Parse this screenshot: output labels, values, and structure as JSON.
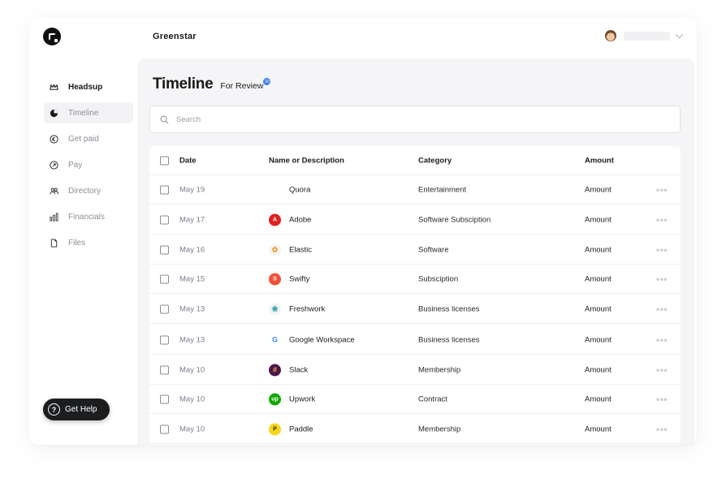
{
  "app": {
    "name": "Greenstar"
  },
  "nav": {
    "items": [
      {
        "label": "Headsup",
        "icon": "crown-icon"
      },
      {
        "label": "Timeline",
        "icon": "pie-chart-icon"
      },
      {
        "label": "Get paid",
        "icon": "euro-circle-icon"
      },
      {
        "label": "Pay",
        "icon": "send-circle-icon"
      },
      {
        "label": "Directory",
        "icon": "users-icon"
      },
      {
        "label": "Financials",
        "icon": "bar-chart-icon"
      },
      {
        "label": "Files",
        "icon": "file-icon"
      }
    ],
    "active": "Timeline"
  },
  "help": {
    "label": "Get Help",
    "icon_glyph": "?"
  },
  "page": {
    "title": "Timeline",
    "subtitle": "For Review",
    "badge": "20"
  },
  "search": {
    "placeholder": "Search",
    "value": ""
  },
  "table": {
    "headers": {
      "date": "Date",
      "name": "Name or Description",
      "category": "Category",
      "amount": "Amount"
    },
    "rows": [
      {
        "date": "May 19",
        "name": "Quora",
        "category": "Entertainment",
        "amount": "Amount",
        "icon": "quora-icon",
        "icon_color": "#ffffff",
        "icon_glyph": ""
      },
      {
        "date": "May 17",
        "name": "Adobe",
        "category": "Software Subsciption",
        "amount": "Amount",
        "icon": "adobe-icon",
        "icon_color": "#e02020",
        "icon_glyph": "A"
      },
      {
        "date": "May 16",
        "name": "Elastic",
        "category": "Software",
        "amount": "Amount",
        "icon": "elastic-icon",
        "icon_color": "#f2f3f5",
        "icon_glyph": "✿"
      },
      {
        "date": "May 15",
        "name": "Swifty",
        "category": "Subsciption",
        "amount": "Amount",
        "icon": "swift-icon",
        "icon_color": "#f05138",
        "icon_glyph": "S"
      },
      {
        "date": "May 13",
        "name": "Freshwork",
        "category": "Business licenses",
        "amount": "Amount",
        "icon": "freshworks-icon",
        "icon_color": "#f2f3f5",
        "icon_glyph": "❀"
      },
      {
        "date": "May 13",
        "name": "Google Workspace",
        "category": "Business licenses",
        "amount": "Amount",
        "icon": "google-icon",
        "icon_color": "#ffffff",
        "icon_glyph": "G"
      },
      {
        "date": "May 10",
        "name": "Slack",
        "category": "Membership",
        "amount": "Amount",
        "icon": "slack-icon",
        "icon_color": "#4a154b",
        "icon_glyph": "#"
      },
      {
        "date": "May 10",
        "name": "Upwork",
        "category": "Contract",
        "amount": "Amount",
        "icon": "upwork-icon",
        "icon_color": "#14a800",
        "icon_glyph": "up"
      },
      {
        "date": "May 10",
        "name": "Paddle",
        "category": "Membership",
        "amount": "Amount",
        "icon": "paddle-icon",
        "icon_color": "#f7d51d",
        "icon_glyph": "P"
      }
    ],
    "more_glyph": "•••"
  }
}
